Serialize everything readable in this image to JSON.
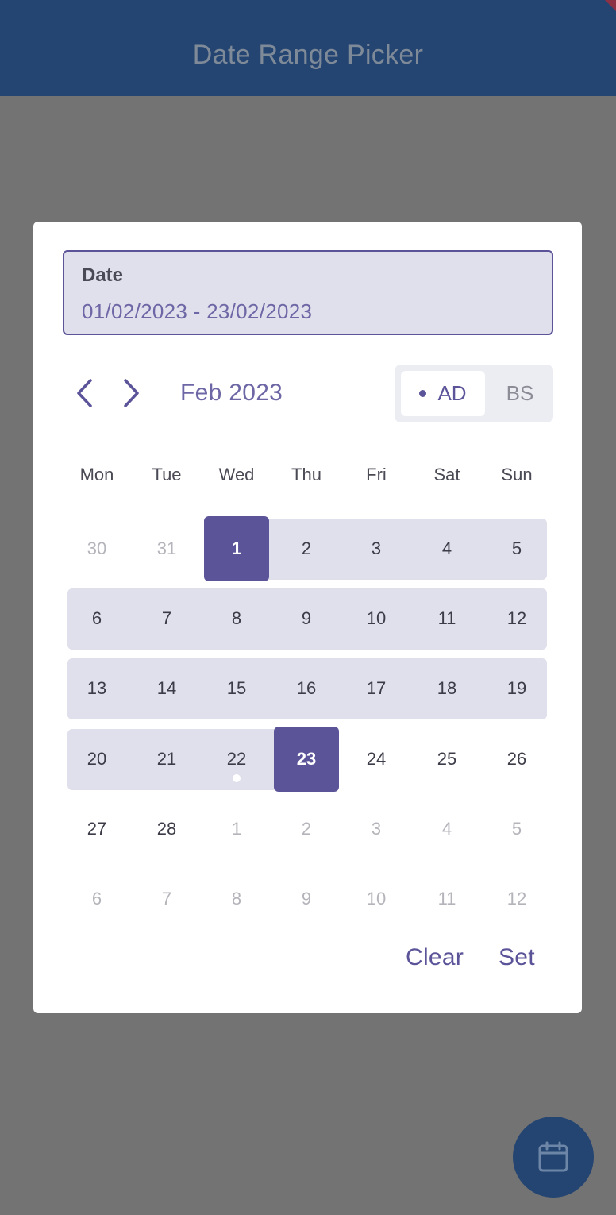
{
  "app": {
    "title": "Date Range Picker"
  },
  "dialog": {
    "field": {
      "label": "Date",
      "value": "01/02/2023 - 23/02/2023"
    },
    "month_label": "Feb 2023",
    "era": {
      "ad_label": "AD",
      "bs_label": "BS",
      "selected": "AD"
    },
    "weekdays": [
      "Mon",
      "Tue",
      "Wed",
      "Thu",
      "Fri",
      "Sat",
      "Sun"
    ],
    "weeks": [
      [
        {
          "t": "30",
          "o": true
        },
        {
          "t": "31",
          "o": true
        },
        {
          "t": "1",
          "s": true
        },
        {
          "t": "2"
        },
        {
          "t": "3"
        },
        {
          "t": "4"
        },
        {
          "t": "5"
        }
      ],
      [
        {
          "t": "6"
        },
        {
          "t": "7"
        },
        {
          "t": "8"
        },
        {
          "t": "9"
        },
        {
          "t": "10"
        },
        {
          "t": "11"
        },
        {
          "t": "12"
        }
      ],
      [
        {
          "t": "13"
        },
        {
          "t": "14"
        },
        {
          "t": "15"
        },
        {
          "t": "16"
        },
        {
          "t": "17"
        },
        {
          "t": "18"
        },
        {
          "t": "19"
        }
      ],
      [
        {
          "t": "20"
        },
        {
          "t": "21"
        },
        {
          "t": "22",
          "today": true
        },
        {
          "t": "23",
          "s": true
        },
        {
          "t": "24"
        },
        {
          "t": "25"
        },
        {
          "t": "26"
        }
      ],
      [
        {
          "t": "27"
        },
        {
          "t": "28"
        },
        {
          "t": "1",
          "o": true
        },
        {
          "t": "2",
          "o": true
        },
        {
          "t": "3",
          "o": true
        },
        {
          "t": "4",
          "o": true
        },
        {
          "t": "5",
          "o": true
        }
      ],
      [
        {
          "t": "6",
          "o": true
        },
        {
          "t": "7",
          "o": true
        },
        {
          "t": "8",
          "o": true
        },
        {
          "t": "9",
          "o": true
        },
        {
          "t": "10",
          "o": true
        },
        {
          "t": "11",
          "o": true
        },
        {
          "t": "12",
          "o": true
        }
      ]
    ],
    "actions": {
      "clear_label": "Clear",
      "set_label": "Set"
    }
  },
  "colors": {
    "primary": "#5b5499",
    "range": "#e0dfec",
    "appbar": "#244571",
    "scrim": "#737373"
  },
  "icons": {
    "prev": "chevron-left-icon",
    "next": "chevron-right-icon",
    "fab": "calendar-icon"
  }
}
